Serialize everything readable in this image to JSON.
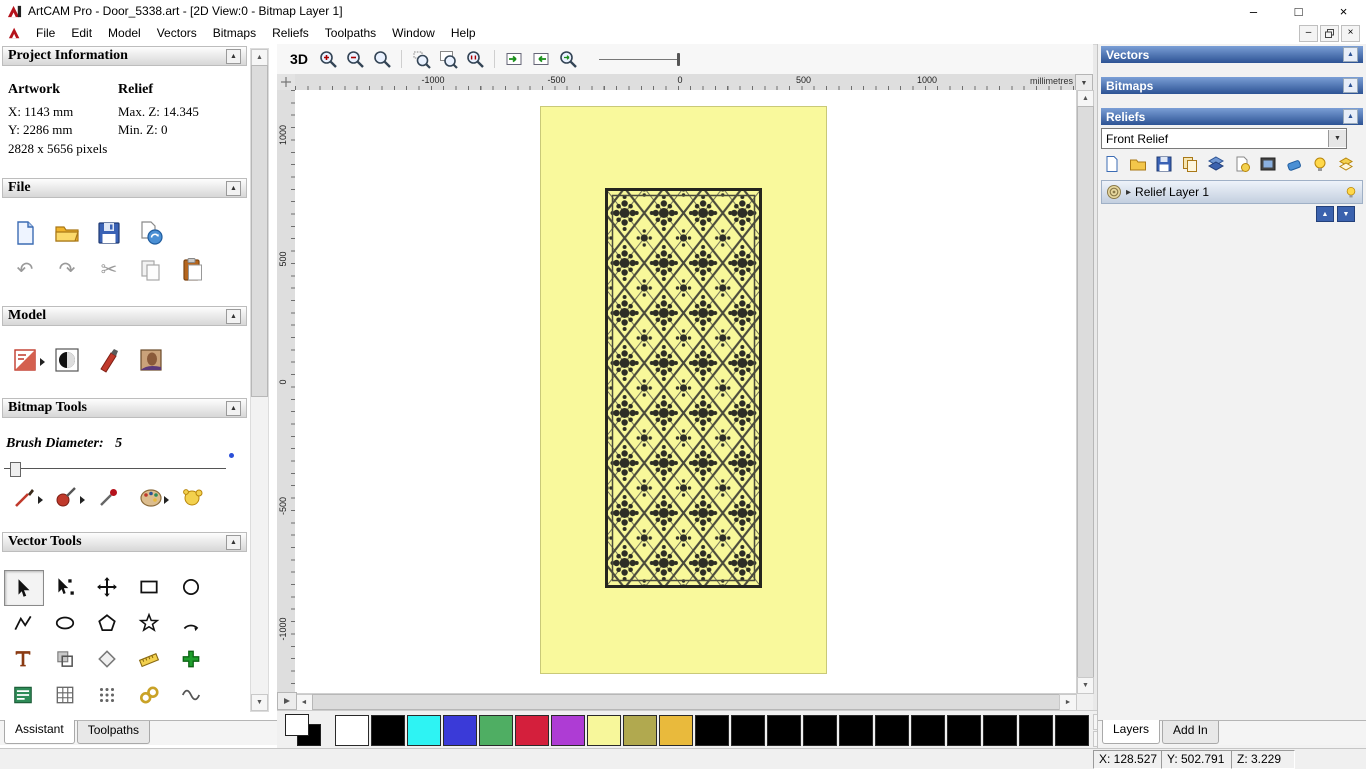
{
  "window": {
    "title": "ArtCAM Pro - Door_5338.art - [2D View:0 - Bitmap Layer 1]"
  },
  "menu": {
    "items": [
      "File",
      "Edit",
      "Model",
      "Vectors",
      "Bitmaps",
      "Reliefs",
      "Toolpaths",
      "Window",
      "Help"
    ]
  },
  "assistant": {
    "project_information": {
      "title": "Project Information",
      "artwork_label": "Artwork",
      "relief_label": "Relief",
      "artwork_x": "X: 1143 mm",
      "artwork_y": "Y: 2286 mm",
      "artwork_pixels": "2828 x 5656 pixels",
      "relief_max": "Max. Z: 14.345",
      "relief_min": "Min. Z: 0"
    },
    "file_title": "File",
    "model_title": "Model",
    "bitmap_tools_title": "Bitmap Tools",
    "brush_diameter_label": "Brush Diameter:",
    "brush_diameter_value": "5",
    "vector_tools_title": "Vector Tools",
    "tabs": [
      "Assistant",
      "Toolpaths"
    ]
  },
  "view": {
    "toolbar_3d": "3D",
    "ruler_units": "millimetres",
    "h_ticks": [
      "-1000",
      "-500",
      "0",
      "500",
      "1000"
    ],
    "v_ticks": [
      "1000",
      "500",
      "0",
      "-500",
      "-1000"
    ]
  },
  "right_panel": {
    "vectors_title": "Vectors",
    "bitmaps_title": "Bitmaps",
    "reliefs_title": "Reliefs",
    "relief_select_value": "Front Relief",
    "layer_name": "Relief Layer 1",
    "tabs": [
      "Layers",
      "Add In"
    ]
  },
  "palette": {
    "colors": [
      "#ffffff",
      "#000000",
      "#2ef3f3",
      "#3a3ad8",
      "#4fae63",
      "#d41f3c",
      "#ae3cd4",
      "#f7f79b",
      "#b1a94f",
      "#e9ba3c",
      "#000000",
      "#000000",
      "#000000",
      "#000000",
      "#000000",
      "#000000",
      "#000000",
      "#000000",
      "#000000",
      "#000000",
      "#000000"
    ]
  },
  "status": {
    "x": "X: 128.527",
    "y": "Y: 502.791",
    "z": "Z: 3.229"
  },
  "glyphs": {
    "collapse": "▲",
    "dropdown": "▼",
    "up": "▲",
    "down": "▼",
    "left": "◄",
    "right": "►",
    "expander": "▸",
    "undo": "↶",
    "redo": "↷",
    "cut": "✂",
    "minimize": "–",
    "maximize": "□",
    "close": "×"
  }
}
